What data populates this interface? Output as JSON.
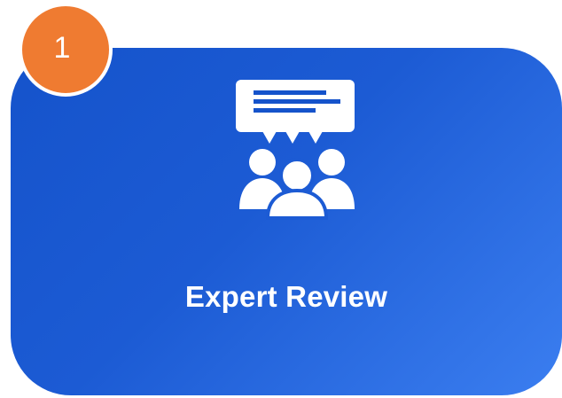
{
  "step": {
    "number": "1",
    "title": "Expert Review",
    "icon": "expert-review-icon"
  },
  "colors": {
    "badge": "#ef7b31",
    "card_start": "#1553cb",
    "card_end": "#3b7ef0",
    "text": "#ffffff"
  }
}
